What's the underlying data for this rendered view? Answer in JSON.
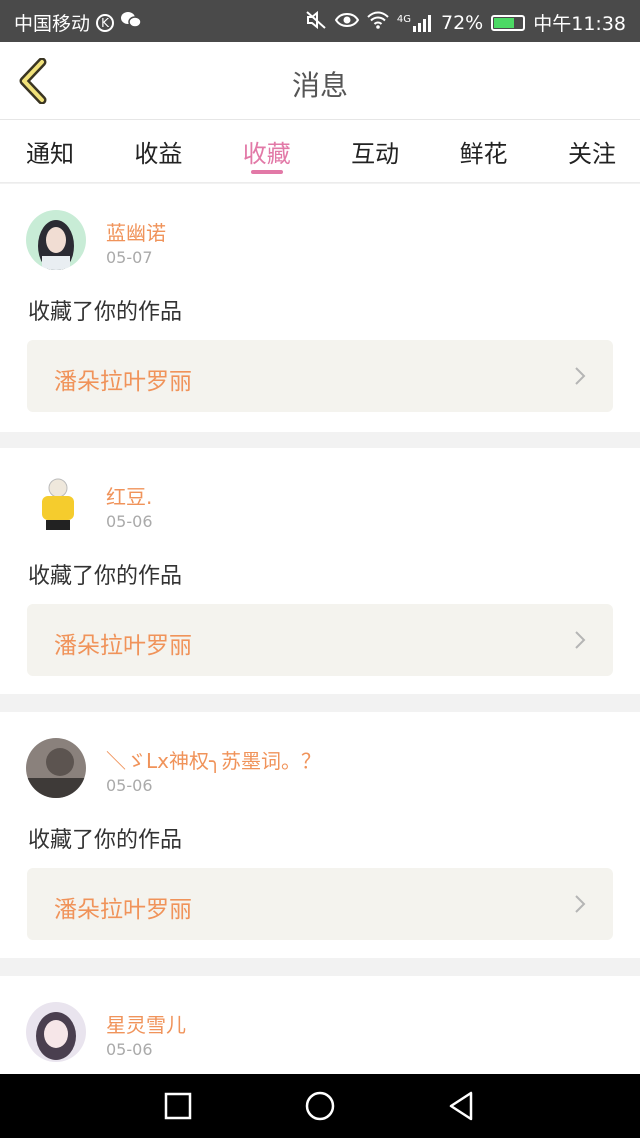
{
  "status_bar": {
    "carrier": "中国移动",
    "k_badge": "K",
    "signal_label": "4G",
    "battery_percent": "72%",
    "battery_level": 0.72,
    "time": "中午11:38"
  },
  "header": {
    "title": "消息"
  },
  "tabs": [
    {
      "label": "通知",
      "active": false
    },
    {
      "label": "收益",
      "active": false
    },
    {
      "label": "收藏",
      "active": true
    },
    {
      "label": "互动",
      "active": false
    },
    {
      "label": "鲜花",
      "active": false
    },
    {
      "label": "关注",
      "active": false
    }
  ],
  "notifications": [
    {
      "name": "蓝幽诺",
      "date": "05-07",
      "message": "收藏了你的作品",
      "work_title": "潘朵拉叶罗丽"
    },
    {
      "name": "红豆.",
      "date": "05-06",
      "message": "收藏了你的作品",
      "work_title": "潘朵拉叶罗丽"
    },
    {
      "name": "＼ゞLx神权╮苏墨词。？",
      "date": "05-06",
      "message": "收藏了你的作品",
      "work_title": "潘朵拉叶罗丽"
    },
    {
      "name": "星灵雪儿",
      "date": "05-06"
    }
  ],
  "colors": {
    "accent_pink": "#e279a7",
    "name_orange": "#f0935a"
  }
}
